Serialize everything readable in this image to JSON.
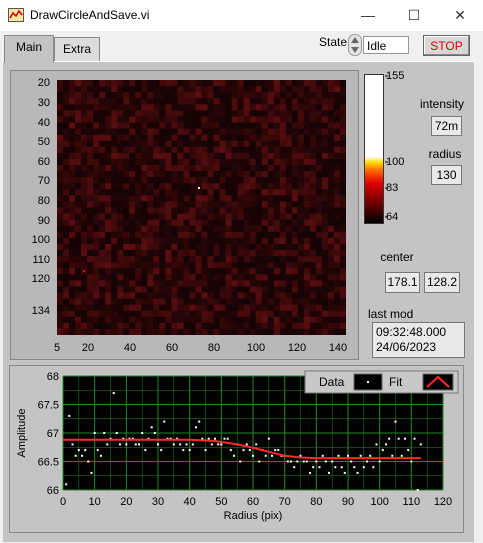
{
  "window": {
    "title": "DrawCircleAndSave.vi"
  },
  "tabs": [
    {
      "label": "Main"
    },
    {
      "label": "Extra"
    }
  ],
  "state": {
    "label": "State",
    "value": "Idle"
  },
  "stop_label": "STOP",
  "image": {
    "y_ticks": [
      "20",
      "30",
      "40",
      "50",
      "60",
      "70",
      "80",
      "90",
      "100",
      "110",
      "120",
      "134"
    ],
    "x_ticks": [
      "5",
      "20",
      "40",
      "60",
      "80",
      "100",
      "120",
      "140"
    ]
  },
  "colorbar": {
    "ticks": [
      "155",
      "100",
      "83",
      "64"
    ]
  },
  "intensity": {
    "label": "intensity",
    "value": "72m"
  },
  "radius": {
    "label": "radius",
    "value": "130"
  },
  "center": {
    "label": "center",
    "x": "178.1",
    "y": "128.2"
  },
  "last_mod": {
    "label": "last mod",
    "time": "09:32:48.000",
    "date": "24/06/2023"
  },
  "chart_data": {
    "type": "scatter",
    "xlabel": "Radius (pix)",
    "ylabel": "Amplitude",
    "xlim": [
      0,
      120
    ],
    "ylim": [
      66,
      68
    ],
    "x_ticks": [
      "0",
      "10",
      "20",
      "30",
      "40",
      "50",
      "60",
      "70",
      "80",
      "90",
      "100",
      "110",
      "120"
    ],
    "y_ticks": [
      "68",
      "67.5",
      "67",
      "66.5",
      "66"
    ],
    "legend": {
      "placement": "top-right",
      "data_label": "Data",
      "fit_label": "Fit"
    },
    "colors": {
      "data": "#ffffff",
      "fit": "#ff2a2a",
      "background": "#000000",
      "grid": "#1e8c1e"
    },
    "series": [
      {
        "name": "Data",
        "points": [
          [
            1,
            66.1
          ],
          [
            2,
            67.3
          ],
          [
            3,
            66.8
          ],
          [
            4,
            66.6
          ],
          [
            5,
            66.7
          ],
          [
            6,
            66.6
          ],
          [
            7,
            66.7
          ],
          [
            8,
            66.5
          ],
          [
            9,
            66.3
          ],
          [
            10,
            67.0
          ],
          [
            11,
            66.7
          ],
          [
            12,
            66.6
          ],
          [
            13,
            67.0
          ],
          [
            14,
            66.8
          ],
          [
            15,
            66.9
          ],
          [
            16,
            67.7
          ],
          [
            17,
            67.0
          ],
          [
            18,
            66.8
          ],
          [
            19,
            66.9
          ],
          [
            20,
            66.8
          ],
          [
            21,
            66.9
          ],
          [
            22,
            66.9
          ],
          [
            23,
            66.8
          ],
          [
            24,
            66.8
          ],
          [
            25,
            67.0
          ],
          [
            26,
            66.7
          ],
          [
            27,
            66.9
          ],
          [
            28,
            67.1
          ],
          [
            29,
            67.0
          ],
          [
            30,
            66.8
          ],
          [
            31,
            66.7
          ],
          [
            32,
            67.2
          ],
          [
            33,
            66.9
          ],
          [
            34,
            66.9
          ],
          [
            35,
            66.8
          ],
          [
            36,
            66.9
          ],
          [
            37,
            66.8
          ],
          [
            38,
            66.7
          ],
          [
            39,
            66.8
          ],
          [
            40,
            66.7
          ],
          [
            41,
            66.8
          ],
          [
            42,
            67.1
          ],
          [
            43,
            67.2
          ],
          [
            44,
            66.9
          ],
          [
            45,
            66.7
          ],
          [
            46,
            66.9
          ],
          [
            47,
            66.8
          ],
          [
            48,
            66.9
          ],
          [
            49,
            66.8
          ],
          [
            50,
            66.8
          ],
          [
            51,
            66.9
          ],
          [
            52,
            66.9
          ],
          [
            53,
            66.7
          ],
          [
            54,
            66.6
          ],
          [
            55,
            66.8
          ],
          [
            56,
            66.5
          ],
          [
            57,
            66.7
          ],
          [
            58,
            66.8
          ],
          [
            59,
            66.7
          ],
          [
            60,
            66.6
          ],
          [
            61,
            66.8
          ],
          [
            62,
            66.5
          ],
          [
            63,
            66.7
          ],
          [
            64,
            66.6
          ],
          [
            65,
            66.9
          ],
          [
            66,
            66.6
          ],
          [
            67,
            66.7
          ],
          [
            68,
            66.7
          ],
          [
            69,
            66.6
          ],
          [
            70,
            66.6
          ],
          [
            71,
            66.5
          ],
          [
            72,
            66.5
          ],
          [
            73,
            66.4
          ],
          [
            74,
            66.5
          ],
          [
            75,
            66.6
          ],
          [
            76,
            66.5
          ],
          [
            77,
            66.5
          ],
          [
            78,
            66.3
          ],
          [
            79,
            66.4
          ],
          [
            80,
            66.5
          ],
          [
            81,
            66.4
          ],
          [
            82,
            66.6
          ],
          [
            83,
            66.5
          ],
          [
            84,
            66.3
          ],
          [
            85,
            66.5
          ],
          [
            86,
            66.4
          ],
          [
            87,
            66.6
          ],
          [
            88,
            66.4
          ],
          [
            89,
            66.3
          ],
          [
            90,
            66.6
          ],
          [
            91,
            66.5
          ],
          [
            92,
            66.4
          ],
          [
            93,
            66.3
          ],
          [
            94,
            66.6
          ],
          [
            95,
            66.4
          ],
          [
            96,
            66.5
          ],
          [
            97,
            66.6
          ],
          [
            98,
            66.4
          ],
          [
            99,
            66.8
          ],
          [
            100,
            66.5
          ],
          [
            101,
            66.7
          ],
          [
            102,
            66.8
          ],
          [
            103,
            66.9
          ],
          [
            104,
            66.6
          ],
          [
            105,
            67.2
          ],
          [
            106,
            66.9
          ],
          [
            107,
            66.6
          ],
          [
            108,
            66.9
          ],
          [
            109,
            66.7
          ],
          [
            110,
            66.5
          ],
          [
            111,
            66.9
          ],
          [
            112,
            66.0
          ],
          [
            113,
            66.8
          ]
        ]
      },
      {
        "name": "Fit",
        "points": [
          [
            0,
            66.88
          ],
          [
            40,
            66.88
          ],
          [
            48,
            66.86
          ],
          [
            55,
            66.8
          ],
          [
            60,
            66.74
          ],
          [
            65,
            66.67
          ],
          [
            70,
            66.6
          ],
          [
            75,
            66.57
          ],
          [
            80,
            66.56
          ],
          [
            113,
            66.56
          ]
        ]
      }
    ]
  }
}
